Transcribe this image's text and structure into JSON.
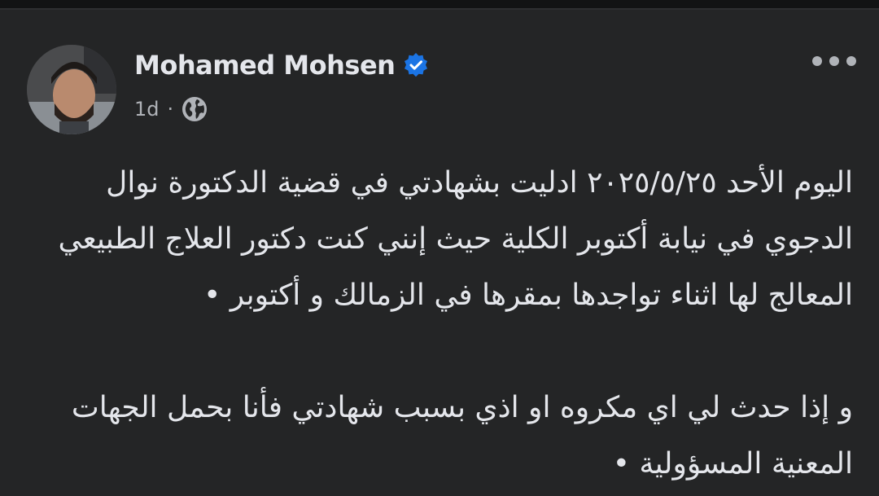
{
  "post": {
    "author_name": "Mohamed Mohsen",
    "verified_icon": "verified-badge-icon",
    "timestamp": "1d",
    "separator": "·",
    "privacy_icon": "globe-icon",
    "more_icon": "more-options-icon",
    "paragraphs": [
      "اليوم الأحد ٢٠٢٥/٥/٢٥ ادليت بشهادتي في قضية الدكتورة نوال الدجوي في نيابة أكتوبر الكلية حيث إنني كنت دكتور العلاج الطبيعي المعالج لها اثناء تواجدها بمقرها في الزمالك و أكتوبر •",
      "و إذا حدث لي اي مكروه او اذي بسبب شهادتي فأنا بحمل الجهات المعنية المسؤولية •"
    ]
  },
  "colors": {
    "background": "#242526",
    "text_primary": "#e4e6eb",
    "text_secondary": "#b0b3b8",
    "verified_blue": "#1b74e4"
  }
}
